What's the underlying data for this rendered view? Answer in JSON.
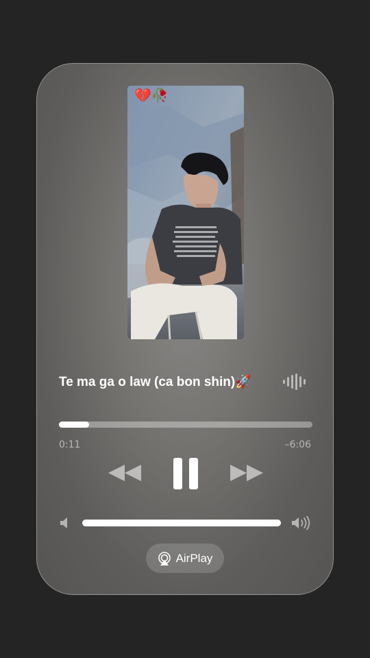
{
  "now_playing": {
    "title": "Te ma ga o law (ca bon shin)🚀",
    "artwork_overlay_text": "💔🥀",
    "elapsed": "0:11",
    "remaining": "–6:06",
    "progress": 0.03
  },
  "controls": {
    "rewind_icon": "rewind-icon",
    "pause_icon": "pause-icon",
    "forward_icon": "fast-forward-icon",
    "waveform_icon": "waveform-icon"
  },
  "volume": {
    "level": 1.0,
    "low_icon": "speaker-low-icon",
    "high_icon": "speaker-high-icon"
  },
  "airplay": {
    "label": "AirPlay",
    "icon": "airplay-icon"
  },
  "colors": {
    "background": "#242424",
    "text": "#ffffff",
    "muted_text": "#b9b8b6"
  }
}
